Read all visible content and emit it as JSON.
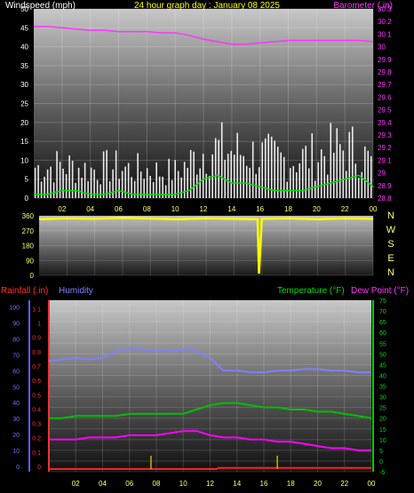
{
  "title": "24 hour graph day : January 08 2025",
  "colors": {
    "wind": "#ffffff",
    "gust_bar": "#ffffff",
    "wind_avg": "#00e000",
    "barometer": "#ff33ff",
    "direction": "#ffff00",
    "humidity": "#8080ff",
    "temperature": "#00c000",
    "dewpoint": "#ff00ff",
    "rainfall": "#ff2020",
    "tick_text": "#ffff66",
    "rain_axis": "#ff3030",
    "humidity_axis": "#7070ff",
    "temp_axis": "#00dd00"
  },
  "x_ticks": [
    "02",
    "04",
    "06",
    "08",
    "10",
    "12",
    "14",
    "16",
    "18",
    "20",
    "22",
    "00"
  ],
  "chart_data": [
    {
      "type": "line",
      "name": "wind_barometer",
      "left_label": "Windspeed (mph)",
      "right_label": "Barometer (.in)",
      "left_ticks": [
        "0",
        "5",
        "10",
        "15",
        "20",
        "25",
        "30",
        "35",
        "40",
        "45",
        "50"
      ],
      "right_ticks": [
        "28.8",
        "28.9",
        "29",
        "29.1",
        "29.2",
        "29.3",
        "29.4",
        "29.5",
        "29.6",
        "29.7",
        "29.8",
        "29.9",
        "30",
        "30.1",
        "30.2",
        "30.3"
      ],
      "ylim_left": [
        0,
        50
      ],
      "ylim_right": [
        28.8,
        30.3
      ],
      "x_range_hours": [
        0,
        24
      ],
      "series": [
        {
          "key": "barometer",
          "x": [
            0,
            1,
            2,
            3,
            4,
            5,
            6,
            7,
            8,
            9,
            10,
            11,
            12,
            13,
            14,
            15,
            16,
            17,
            18,
            19,
            20,
            21,
            22,
            23,
            24
          ],
          "values": [
            30.16,
            30.16,
            30.15,
            30.14,
            30.13,
            30.13,
            30.12,
            30.12,
            30.12,
            30.11,
            30.11,
            30.09,
            30.06,
            30.04,
            30.02,
            30.02,
            30.03,
            30.04,
            30.05,
            30.05,
            30.05,
            30.05,
            30.05,
            30.05,
            30.04
          ]
        },
        {
          "key": "wind_avg",
          "x": [
            0,
            1,
            2,
            3,
            4,
            5,
            6,
            7,
            8,
            9,
            10,
            11,
            12,
            13,
            14,
            15,
            16,
            17,
            18,
            19,
            20,
            21,
            22,
            23,
            24
          ],
          "values": [
            1,
            1,
            2,
            2,
            1,
            1,
            2,
            1,
            1,
            1,
            1,
            2,
            5,
            6,
            4,
            4,
            3,
            2,
            2,
            2,
            3,
            4,
            5,
            6,
            3
          ]
        },
        {
          "key": "gust_envelope",
          "x": [
            0,
            1,
            2,
            3,
            4,
            5,
            6,
            7,
            8,
            9,
            10,
            11,
            12,
            13,
            14,
            15,
            16,
            17,
            18,
            19,
            20,
            21,
            22,
            23,
            24
          ],
          "values": [
            13,
            13,
            14,
            13,
            12,
            13,
            13,
            12,
            12,
            11,
            11,
            15,
            20,
            21,
            20,
            19,
            18,
            17,
            16,
            17,
            18,
            20,
            21,
            20,
            14
          ]
        }
      ]
    },
    {
      "type": "line",
      "name": "wind_direction",
      "left_ticks": [
        "0",
        "90",
        "180",
        "270",
        "360"
      ],
      "right_ticks": [
        "N",
        "W",
        "S",
        "E",
        "N"
      ],
      "ylim": [
        0,
        360
      ],
      "series": [
        {
          "key": "direction",
          "x": [
            0,
            2,
            4,
            6,
            8,
            10,
            12,
            14,
            15.7,
            15.8,
            16,
            18,
            20,
            22,
            24
          ],
          "values": [
            340,
            345,
            342,
            348,
            344,
            340,
            345,
            343,
            340,
            10,
            342,
            345,
            340,
            345,
            342
          ]
        }
      ]
    },
    {
      "type": "line",
      "name": "temp_humidity_rain",
      "rain_label": "Rainfall (.in)",
      "humidity_label": "Humidity",
      "temp_label": "Temperature (°F)",
      "dew_label": "Dew Point (°F)",
      "humidity_ticks": [
        "0",
        "10",
        "20",
        "30",
        "40",
        "50",
        "60",
        "70",
        "80",
        "90",
        "100"
      ],
      "rain_ticks": [
        "0",
        "0.1",
        "0.2",
        "0.3",
        "0.4",
        "0.5",
        "0.6",
        "0.7",
        "0.8",
        "0.9",
        "1",
        "1.1"
      ],
      "temp_ticks": [
        "-5",
        "0",
        "5",
        "10",
        "15",
        "20",
        "25",
        "30",
        "35",
        "40",
        "45",
        "50",
        "55",
        "60",
        "65",
        "70",
        "75"
      ],
      "ylim_temp": [
        -5,
        75
      ],
      "series": [
        {
          "key": "humidity",
          "x": [
            0,
            1,
            2,
            3,
            4,
            5,
            6,
            7,
            8,
            9,
            10,
            10.5,
            11,
            12,
            13,
            14,
            15,
            16,
            17,
            18,
            19,
            20,
            21,
            22,
            23,
            24
          ],
          "values": [
            66,
            67,
            68,
            67,
            68,
            72,
            74,
            73,
            73,
            73,
            73,
            74,
            72,
            68,
            60,
            60,
            59,
            59,
            60,
            60,
            61,
            61,
            60,
            60,
            59,
            59
          ]
        },
        {
          "key": "temperature",
          "x": [
            0,
            1,
            2,
            3,
            4,
            5,
            6,
            7,
            8,
            9,
            10,
            11,
            12,
            13,
            14,
            15,
            16,
            17,
            18,
            19,
            20,
            21,
            22,
            23,
            24
          ],
          "values": [
            20,
            20,
            21,
            21,
            21,
            21,
            22,
            22,
            22,
            22,
            22,
            24,
            26,
            27,
            27,
            26,
            25,
            25,
            24,
            24,
            23,
            23,
            22,
            21,
            20
          ]
        },
        {
          "key": "dewpoint",
          "x": [
            0,
            1,
            2,
            3,
            4,
            5,
            6,
            7,
            8,
            9,
            10,
            11,
            12,
            13,
            14,
            15,
            16,
            17,
            18,
            19,
            20,
            21,
            22,
            23,
            24
          ],
          "values": [
            10,
            10,
            10,
            11,
            11,
            11,
            12,
            12,
            12,
            13,
            14,
            14,
            12,
            11,
            11,
            10,
            10,
            9,
            9,
            8,
            7,
            6,
            6,
            5,
            5
          ]
        },
        {
          "key": "rainfall",
          "x": [
            0,
            12.5,
            12.6,
            24
          ],
          "values": [
            0.0,
            0.0,
            0.02,
            0.02
          ]
        }
      ],
      "markers_hours": [
        7.6,
        17.0
      ]
    }
  ]
}
